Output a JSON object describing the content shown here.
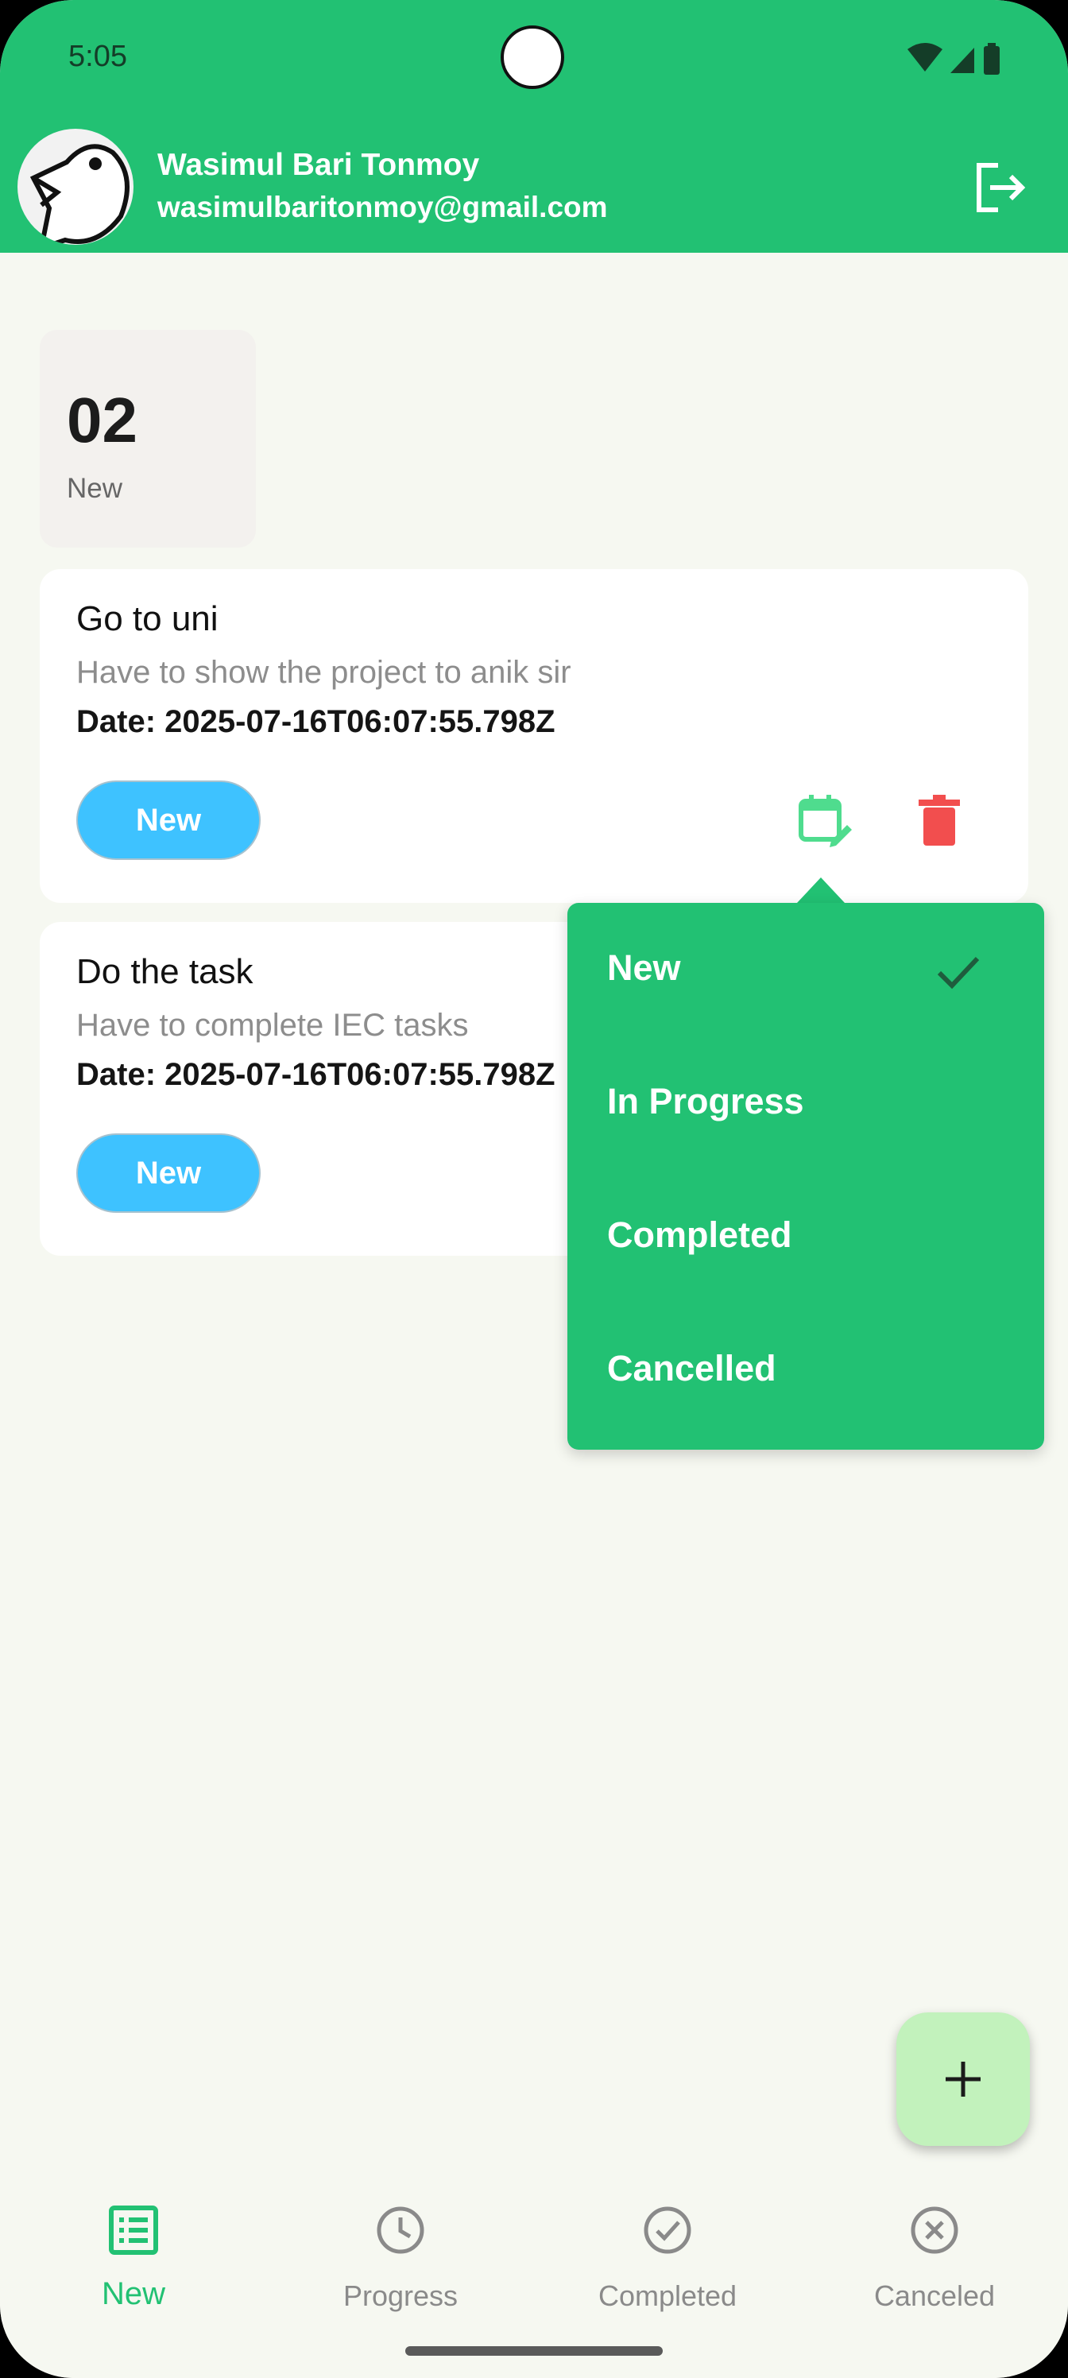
{
  "status_bar": {
    "time": "5:05"
  },
  "user": {
    "name": "Wasimul Bari Tonmoy",
    "email": "wasimulbaritonmoy@gmail.com"
  },
  "summary": {
    "count": "02",
    "label": "New"
  },
  "tasks": [
    {
      "title": "Go to uni",
      "description": "Have to show the project to anik sir",
      "date": "Date: 2025-07-16T06:07:55.798Z",
      "status": "New"
    },
    {
      "title": "Do the task",
      "description": "Have to complete IEC tasks",
      "date": "Date: 2025-07-16T06:07:55.798Z",
      "status": "New"
    }
  ],
  "status_menu": {
    "items": [
      "New",
      "In Progress",
      "Completed",
      "Cancelled"
    ],
    "selected": "New"
  },
  "bottom_nav": {
    "items": [
      {
        "label": "New",
        "icon": "list-icon",
        "active": true
      },
      {
        "label": "Progress",
        "icon": "clock-icon",
        "active": false
      },
      {
        "label": "Completed",
        "icon": "check-circle-icon",
        "active": false
      },
      {
        "label": "Canceled",
        "icon": "cancel-circle-icon",
        "active": false
      }
    ]
  },
  "colors": {
    "primary": "#22c173",
    "background": "#f6f8f1",
    "pill": "#3ec2ff",
    "delete": "#f24e4e",
    "edit": "#4fdc8e",
    "fab": "#c2f2bc"
  }
}
